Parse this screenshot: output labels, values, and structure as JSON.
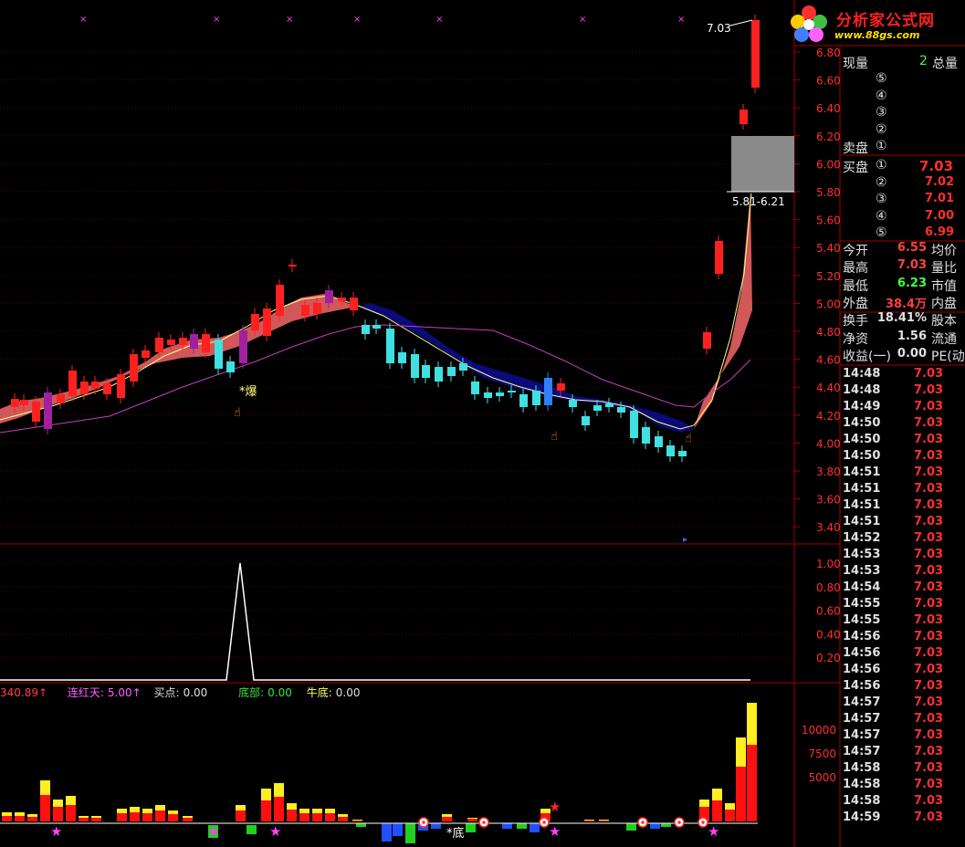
{
  "logo": {
    "title": "分析家公式网",
    "url": "www.88gs.com"
  },
  "main_chart": {
    "y_ticks": [
      "6.80",
      "6.60",
      "6.40",
      "6.20",
      "6.00",
      "5.80",
      "5.60",
      "5.40",
      "5.20",
      "5.00",
      "4.80",
      "4.60",
      "4.40",
      "4.20",
      "4.00",
      "3.80",
      "3.60",
      "3.40"
    ],
    "price_tag": "7.03",
    "range_label": "5.81-6.21",
    "annotation_bao": "*爆",
    "annotation_di": "*底",
    "colors": {
      "up": "#ff2020",
      "down": "#40e0e0",
      "ma_fast": "#ffff80",
      "ma_slow": "#d040d0",
      "band_up": "#e06060",
      "band_down": "#101080"
    }
  },
  "sub_chart": {
    "y_ticks": [
      "1.00",
      "0.80",
      "0.60",
      "0.40",
      "0.20"
    ]
  },
  "indicator_bar": {
    "v1": "340.89↑",
    "lianhong_label": "连红天:",
    "lianhong_value": "5.00↑",
    "maidian_label": "买点:",
    "maidian_value": "0.00",
    "dibu_label": "底部:",
    "dibu_value": "0.00",
    "niudi_label": "牛底:",
    "niudi_value": "0.00"
  },
  "vol_chart": {
    "y_ticks": [
      "10000",
      "7500",
      "5000"
    ]
  },
  "quote": {
    "xianliang_label": "现量",
    "xianliang_value": "2",
    "zongliang_label": "总量",
    "sell_label": "卖盘",
    "sell_levels": [
      "⑤",
      "④",
      "③",
      "②",
      "①"
    ],
    "buy_label": "买盘",
    "buy_levels": [
      {
        "num": "①",
        "price": "7.03"
      },
      {
        "num": "②",
        "price": "7.02"
      },
      {
        "num": "③",
        "price": "7.01"
      },
      {
        "num": "④",
        "price": "7.00"
      },
      {
        "num": "⑤",
        "price": "6.99"
      }
    ],
    "stats": [
      {
        "l": "今开",
        "v": "6.55",
        "r": "均价",
        "c": "#ff4040"
      },
      {
        "l": "最高",
        "v": "7.03",
        "r": "量比",
        "c": "#ff4040"
      },
      {
        "l": "最低",
        "v": "6.23",
        "r": "市值",
        "c": "#40ff40"
      },
      {
        "l": "外盘",
        "v": "38.4万",
        "r": "内盘",
        "c": "#ff4040"
      },
      {
        "l": "换手",
        "v": "18.41%",
        "r": "股本",
        "c": "#e0e0e0"
      },
      {
        "l": "净资",
        "v": "1.56",
        "r": "流通",
        "c": "#e0e0e0"
      },
      {
        "l": "收益(一)",
        "v": "0.00",
        "r": "PE(动)",
        "c": "#e0e0e0"
      }
    ],
    "ticks": [
      {
        "t": "14:48",
        "p": "7.03"
      },
      {
        "t": "14:48",
        "p": "7.03"
      },
      {
        "t": "14:49",
        "p": "7.03"
      },
      {
        "t": "14:50",
        "p": "7.03"
      },
      {
        "t": "14:50",
        "p": "7.03"
      },
      {
        "t": "14:50",
        "p": "7.03"
      },
      {
        "t": "14:51",
        "p": "7.03"
      },
      {
        "t": "14:51",
        "p": "7.03"
      },
      {
        "t": "14:51",
        "p": "7.03"
      },
      {
        "t": "14:51",
        "p": "7.03"
      },
      {
        "t": "14:52",
        "p": "7.03"
      },
      {
        "t": "14:53",
        "p": "7.03"
      },
      {
        "t": "14:53",
        "p": "7.03"
      },
      {
        "t": "14:54",
        "p": "7.03"
      },
      {
        "t": "14:55",
        "p": "7.03"
      },
      {
        "t": "14:55",
        "p": "7.03"
      },
      {
        "t": "14:56",
        "p": "7.03"
      },
      {
        "t": "14:56",
        "p": "7.03"
      },
      {
        "t": "14:56",
        "p": "7.03"
      },
      {
        "t": "14:56",
        "p": "7.03"
      },
      {
        "t": "14:57",
        "p": "7.03"
      },
      {
        "t": "14:57",
        "p": "7.03"
      },
      {
        "t": "14:57",
        "p": "7.03"
      },
      {
        "t": "14:57",
        "p": "7.03"
      },
      {
        "t": "14:58",
        "p": "7.03"
      },
      {
        "t": "14:58",
        "p": "7.03"
      },
      {
        "t": "14:58",
        "p": "7.03"
      },
      {
        "t": "14:59",
        "p": "7.03"
      }
    ]
  }
}
